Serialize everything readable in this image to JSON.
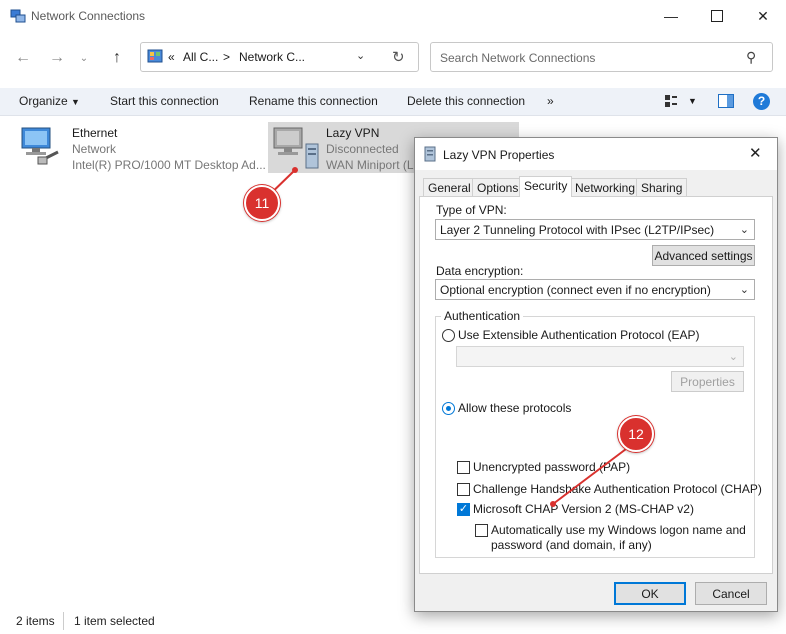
{
  "window": {
    "title": "Network Connections"
  },
  "nav": {
    "breadcrumb_prefix": "«",
    "crumb1": "All C...",
    "crumb_sep": ">",
    "crumb2": "Network C...",
    "search_placeholder": "Search Network Connections"
  },
  "toolbar": {
    "organize": "Organize",
    "start": "Start this connection",
    "rename": "Rename this connection",
    "delete": "Delete this connection",
    "more": "»"
  },
  "items": [
    {
      "name": "Ethernet",
      "status": "Network",
      "device": "Intel(R) PRO/1000 MT Desktop Ad..."
    },
    {
      "name": "Lazy VPN",
      "status": "Disconnected",
      "device": "WAN Miniport (L"
    }
  ],
  "statusbar": {
    "count": "2 items",
    "selected": "1 item selected"
  },
  "dialog": {
    "title": "Lazy VPN Properties",
    "tabs": [
      "General",
      "Options",
      "Security",
      "Networking",
      "Sharing"
    ],
    "active_tab": "Security",
    "type_label": "Type of VPN:",
    "type_value": "Layer 2 Tunneling Protocol with IPsec (L2TP/IPsec)",
    "advanced": "Advanced settings",
    "enc_label": "Data encryption:",
    "enc_value": "Optional encryption (connect even if no encryption)",
    "auth_label": "Authentication",
    "eap_label": "Use Extensible Authentication Protocol (EAP)",
    "properties": "Properties",
    "allow_label": "Allow these protocols",
    "pap": "Unencrypted password (PAP)",
    "chap": "Challenge Handshake Authentication Protocol (CHAP)",
    "mschap": "Microsoft CHAP Version 2 (MS-CHAP v2)",
    "auto_line1": "Automatically use my Windows logon name and",
    "auto_line2": "password (and domain, if any)",
    "ok": "OK",
    "cancel": "Cancel"
  },
  "annotations": {
    "step1": "11",
    "step2": "12",
    "color": "#d9312e"
  }
}
